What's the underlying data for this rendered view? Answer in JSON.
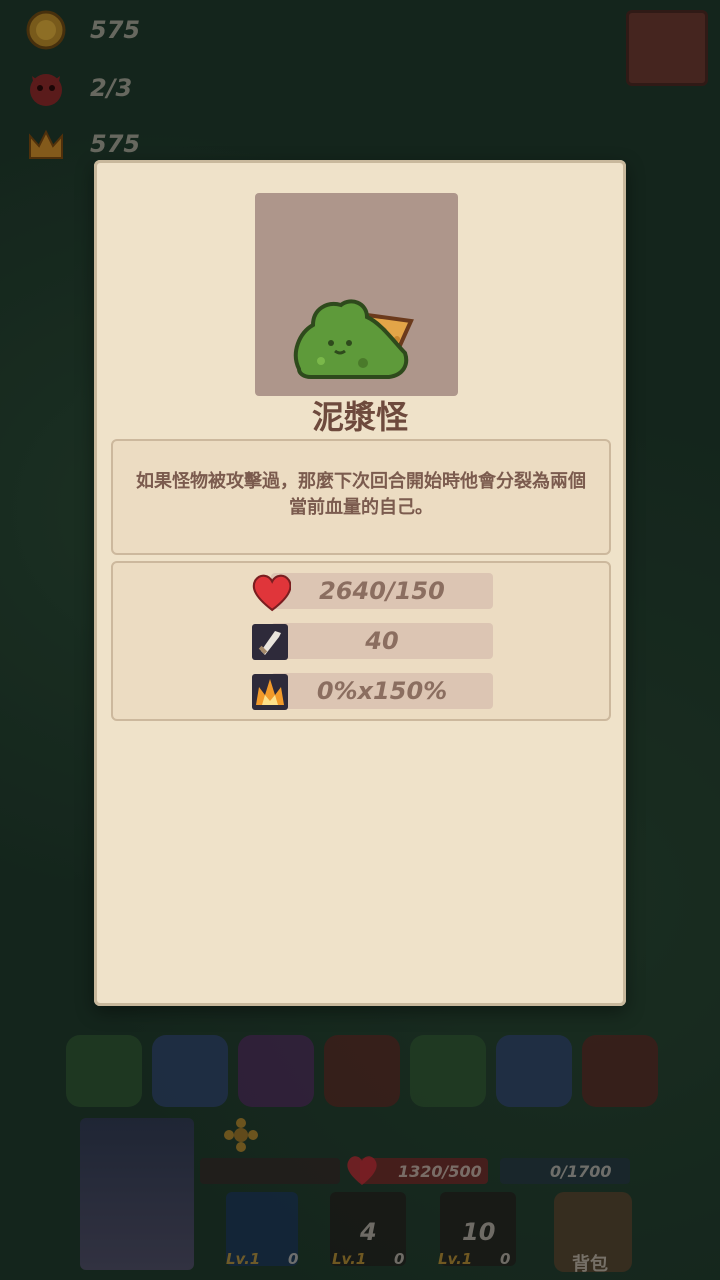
{
  "hud_top": {
    "gold": "575",
    "monsters": "2/3",
    "crown": "575"
  },
  "modal": {
    "title": "泥漿怪",
    "description": "如果怪物被攻擊過，那麼下次回合開始時他會分裂為兩個當前血量的自己。",
    "stats": {
      "hp": "2640/150",
      "attack": "40",
      "crit": "0%x150%"
    }
  },
  "hud_bottom": {
    "hp": "1320/500",
    "xp": "0/1700",
    "skill1_count": "4",
    "skill2_count": "10",
    "lv1": "Lv.1",
    "lv2": "Lv.1",
    "lv3": "Lv.1",
    "zero1": "0",
    "zero2": "0",
    "zero3": "0",
    "backpack": "背包"
  },
  "colors": {
    "panel": "#efe2c9",
    "title": "#6e4a3d",
    "heart": "#e0353a"
  }
}
